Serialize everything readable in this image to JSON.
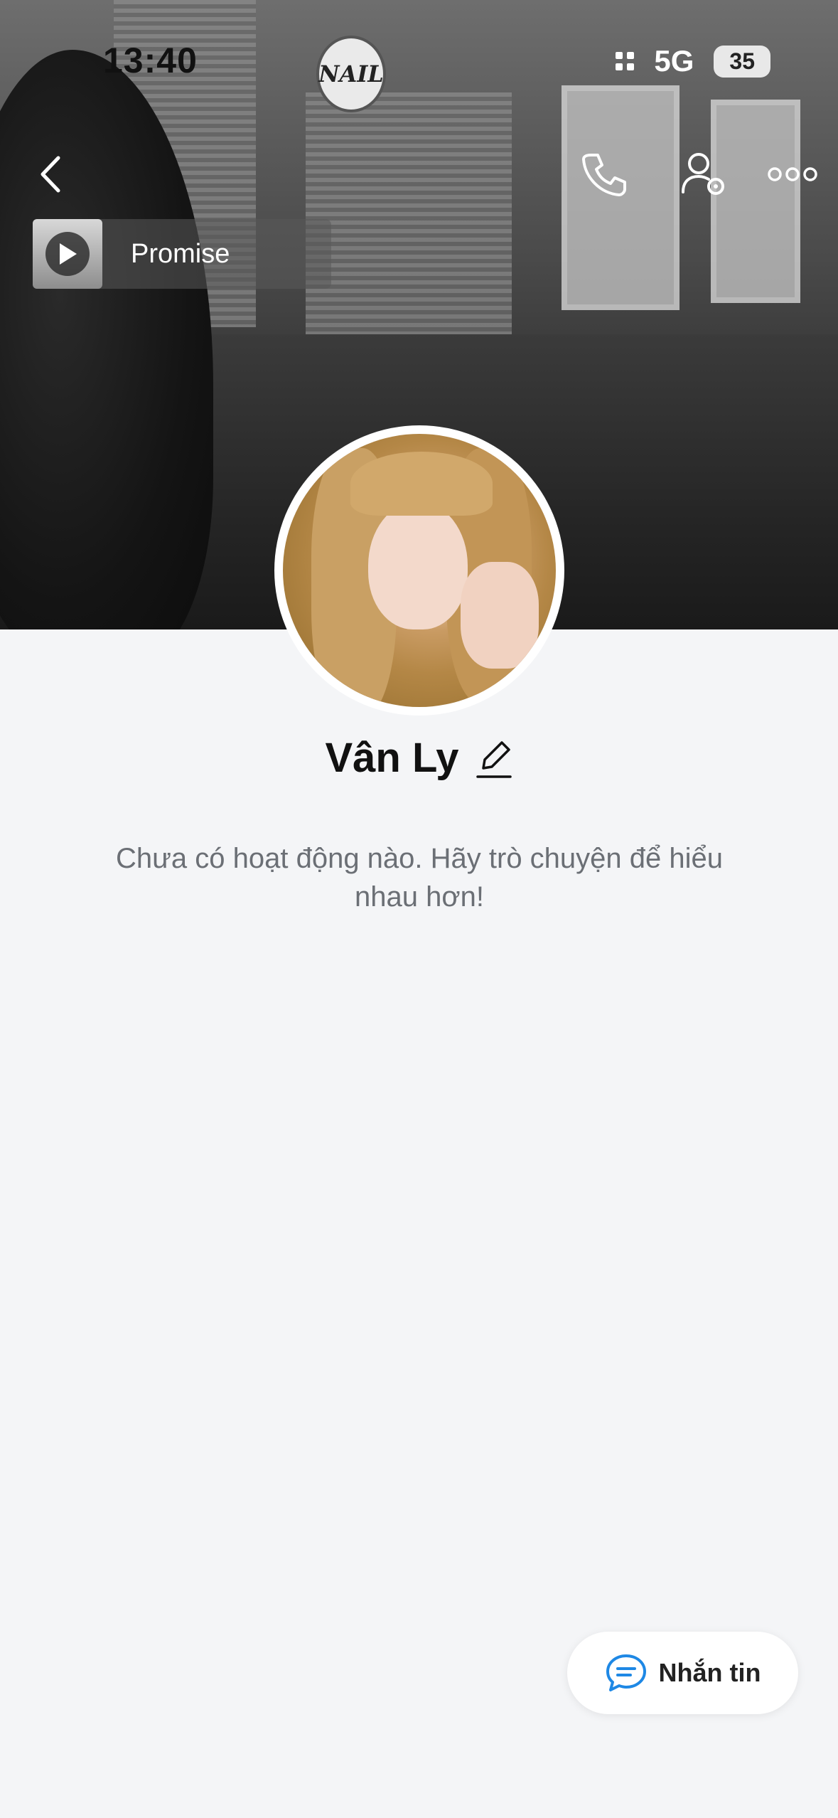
{
  "status_bar": {
    "time": "13:40",
    "network": "5G",
    "battery": "35"
  },
  "header": {
    "back_icon": "chevron-left-icon",
    "call_icon": "phone-icon",
    "settings_icon": "user-settings-icon",
    "more_icon": "more-horizontal-icon"
  },
  "profile_music": {
    "title": "Promise",
    "icon": "play-icon"
  },
  "cover": {
    "sign_text": "NAIL"
  },
  "profile": {
    "name": "Vân Ly",
    "edit_icon": "pencil-icon"
  },
  "activity": {
    "empty_message": "Chưa có hoạt động nào. Hãy trò chuyện để hiểu nhau hơn!"
  },
  "fab": {
    "label": "Nhắn tin",
    "icon": "chat-icon",
    "accent": "#1e88e5"
  }
}
